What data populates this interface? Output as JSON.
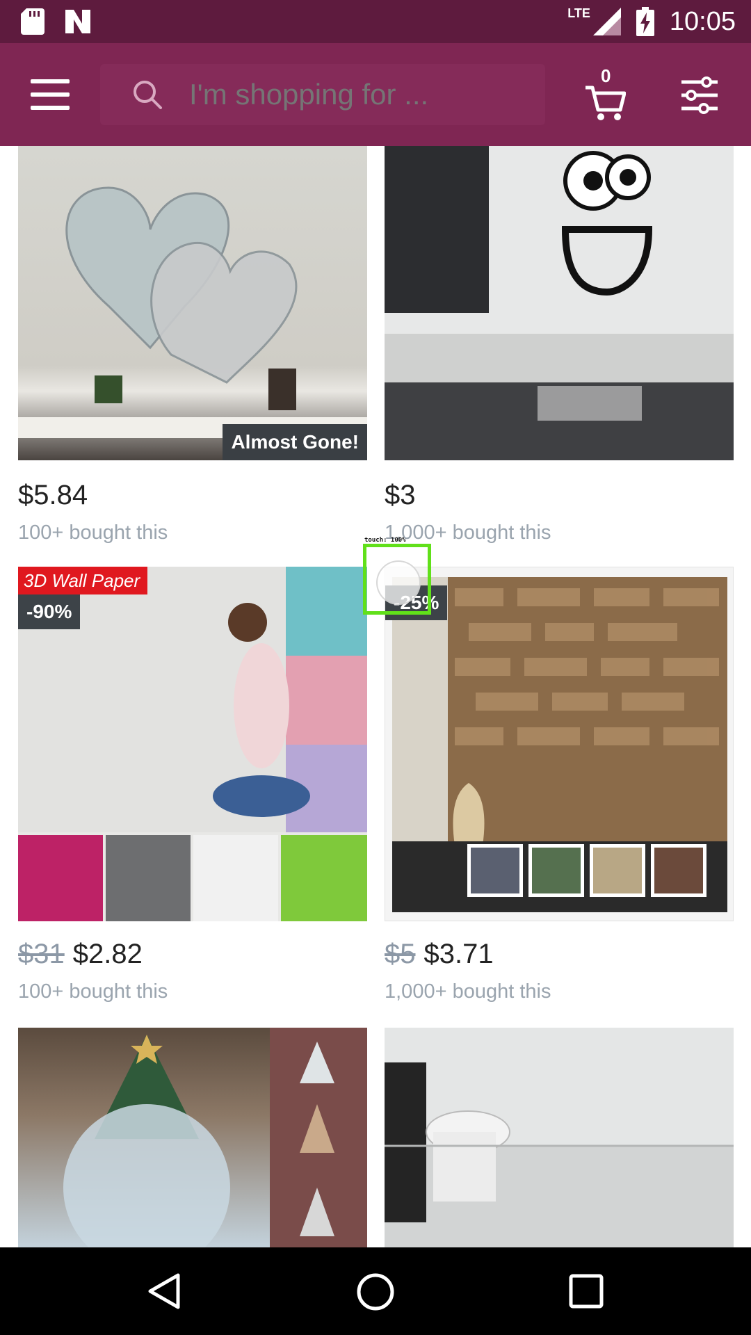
{
  "status_bar": {
    "network": "LTE",
    "time": "10:05",
    "icons": [
      "sd-card-icon",
      "n-notification-icon",
      "signal-icon",
      "battery-charging-icon"
    ]
  },
  "header": {
    "search_placeholder": "I'm shopping for ...",
    "cart_count": "0",
    "colors": {
      "status_bar": "#5e1b3e",
      "app_bar": "#7f2653"
    }
  },
  "products": [
    {
      "price": "$5.84",
      "old_price": "",
      "bought": "100+ bought this",
      "badge": "",
      "overlay": "Almost Gone!",
      "tag": ""
    },
    {
      "price": "$3",
      "old_price": "",
      "bought": "1,000+ bought this",
      "badge": "",
      "overlay": "",
      "tag": ""
    },
    {
      "price": "$2.82",
      "old_price": "$31",
      "bought": "100+ bought this",
      "badge": "-90%",
      "overlay": "",
      "tag": "3D Wall Paper"
    },
    {
      "price": "$3.71",
      "old_price": "$5",
      "bought": "1,000+ bought this",
      "badge": "-25%",
      "overlay": "",
      "tag": ""
    },
    {
      "price": "",
      "old_price": "",
      "bought": "",
      "badge": "",
      "overlay": "",
      "tag": ""
    },
    {
      "price": "",
      "old_price": "",
      "bought": "",
      "badge": "",
      "overlay": "",
      "tag": ""
    }
  ],
  "touch_indicator": {
    "label": "touch: 100%"
  }
}
